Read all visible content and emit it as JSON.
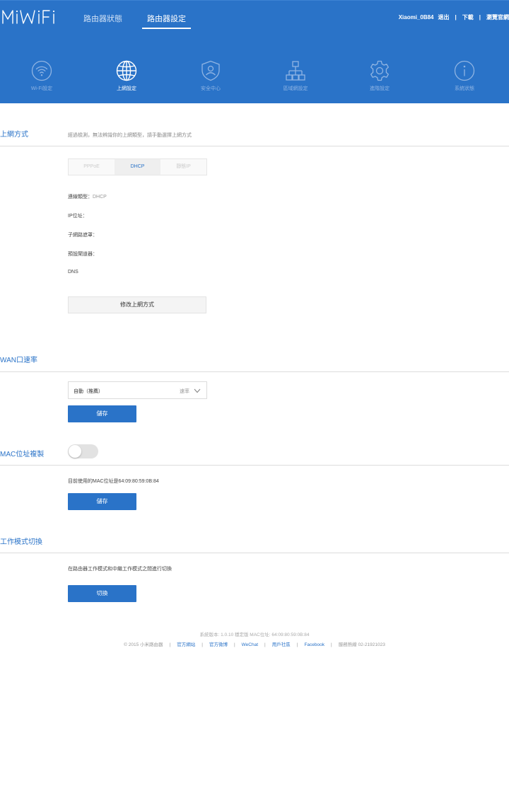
{
  "header": {
    "logo_text": "MiWiFi",
    "tabs": [
      {
        "label": "路由器狀態",
        "active": false
      },
      {
        "label": "路由器設定",
        "active": true
      }
    ],
    "links": {
      "device": "Xiaomi_0B84",
      "logout": "退出",
      "download": "下載",
      "browser": "瀏覽官網"
    }
  },
  "nav": [
    {
      "label": "Wi-Fi設定",
      "icon": "wifi-icon",
      "active": false
    },
    {
      "label": "上網設定",
      "icon": "globe-icon",
      "active": true
    },
    {
      "label": "安全中心",
      "icon": "shield-icon",
      "active": false
    },
    {
      "label": "區域網設定",
      "icon": "network-icon",
      "active": false
    },
    {
      "label": "進階設定",
      "icon": "gear-icon",
      "active": false
    },
    {
      "label": "系統狀態",
      "icon": "info-icon",
      "active": false
    }
  ],
  "internet": {
    "title": "上網方式",
    "note": "經過檢測，無法辨識你的上網類型，請手動選擇上網方式",
    "modes": [
      {
        "label": "PPPoE",
        "active": false
      },
      {
        "label": "DHCP",
        "active": true
      },
      {
        "label": "靜態IP",
        "active": false
      }
    ],
    "conn_type_label": "連線類型：",
    "conn_type_value": "DHCP",
    "ip_label": "IP位址：",
    "subnet_label": "子網路遮罩：",
    "gateway_label": "預設閘道器：",
    "dns_label": "DNS",
    "modify_button": "修改上網方式"
  },
  "wan": {
    "title": "WAN口速率",
    "select_value": "自動（推薦）",
    "select_suffix": "速率",
    "save_button": "儲存"
  },
  "mac": {
    "title": "MAC位址複製",
    "toggle_on": false,
    "current_text": "目前使用的MAC位址是64:09:80:59:0B:84",
    "save_button": "儲存"
  },
  "mode": {
    "title": "工作模式切換",
    "description": "在路由器工作模式和中繼工作模式之間進行切換",
    "switch_button": "切換"
  },
  "footer": {
    "version_line": "系統版本: 1.0.10 穩定版 MAC位址: 64:09:80:59:0B:84",
    "copyright": "© 2015 小米路由器",
    "links": [
      "官方網站",
      "官方微博",
      "WeChat",
      "用戶社區",
      "Facebook"
    ],
    "hotline": "服務熱線 02-21921023"
  },
  "colors": {
    "brand": "#2a73c8",
    "header_bg": "#2a73c8",
    "button_bg": "#2a73c8"
  }
}
